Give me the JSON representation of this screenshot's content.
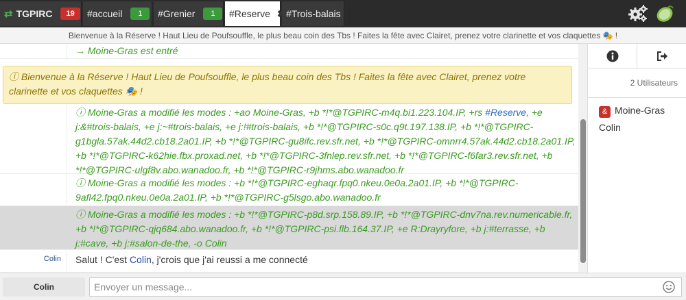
{
  "tabs": {
    "server": {
      "label": "TGPIRC",
      "badge": "19"
    },
    "accueil": {
      "label": "#accueil",
      "badge": "1"
    },
    "grenier": {
      "label": "#Grenier",
      "badge": "1"
    },
    "reserve": {
      "label": "#Reserve",
      "close": "✖"
    },
    "trois": {
      "label": "#Trois-balais"
    }
  },
  "topic": "Bienvenue à la Réserve ! Haut Lieu de Poufsouffle, le plus beau coin des Tbs ! Faites la fête avec Clairet, prenez votre clarinette et vos claquettes 🎭 !",
  "messages": {
    "join": "→ Moine-Gras est entré",
    "welcome": "ⓘ Bienvenue à la Réserve ! Haut Lieu de Poufsouffle, le plus beau coin des Tbs ! Faites la fête avec Clairet, prenez votre clarinette et vos claquettes 🎭 !",
    "mode1_pre": "ⓘ Moine-Gras a modifié les modes : +ao Moine-Gras, +b *!*@TGPIRC-m4q.bi1.223.104.IP, +rs ",
    "mode1_chan": "#Reserve",
    "mode1_post": ", +e j:&#trois-balais, +e j:~#trois-balais, +e j:!#trois-balais, +b *!*@TGPIRC-s0c.q9t.197.138.IP, +b *!*@TGPIRC-g1bgla.57ak.44d2.cb18.2a01.IP, +b *!*@TGPIRC-gu8ifc.rev.sfr.net, +b *!*@TGPIRC-omnrr4.57ak.44d2.cb18.2a01.IP, +b *!*@TGPIRC-k62hie.fbx.proxad.net, +b *!*@TGPIRC-3fnlep.rev.sfr.net, +b *!*@TGPIRC-f6far3.rev.sfr.net, +b *!*@TGPIRC-ulgf8v.abo.wanadoo.fr, +b *!*@TGPIRC-r9jhms.abo.wanadoo.fr",
    "mode2": "ⓘ Moine-Gras a modifié les modes : +b *!*@TGPIRC-eghaqr.fpq0.nkeu.0e0a.2a01.IP, +b *!*@TGPIRC-9afl42.fpq0.nkeu.0e0a.2a01.IP, +b *!*@TGPIRC-g5lsgo.abo.wanadoo.fr",
    "mode3": "ⓘ Moine-Gras a modifié les modes : +b *!*@TGPIRC-p8d.srp.158.89.IP, +b *!*@TGPIRC-dnv7na.rev.numericable.fr, +b *!*@TGPIRC-qjq684.abo.wanadoo.fr, +b *!*@TGPIRC-psi.flb.164.37.IP, +e R:Drayryfore, +b j:#terrasse, +b j:#cave, +b j:#salon-de-the, -o Colin",
    "chat_nick": "Colin",
    "chat_pre": "Salut ! C'est ",
    "chat_mention": "Colin",
    "chat_post": ", j'crois que j'ai reussi a me connecté"
  },
  "sidebar": {
    "user_count": "2 Utilisateurs",
    "users": [
      {
        "name": "Moine-Gras",
        "prefix": "&"
      },
      {
        "name": "Colin"
      }
    ]
  },
  "input": {
    "nick": "Colin",
    "placeholder": "Envoyer un message..."
  },
  "colors": {
    "topbar": "#2b2b2b",
    "badge_red": "#c9302c",
    "badge_green": "#3c9a3c",
    "mode_text": "#3a9b20",
    "channel_link": "#2b6cc4",
    "highlight_bg": "#fbf2c4"
  },
  "icons": {
    "server": "arrows-exchange-icon",
    "settings": "gears-icon",
    "logo": "lime-icon",
    "info": "info-circle-icon",
    "leave": "sign-out-icon",
    "emoji": "smiley-icon"
  }
}
